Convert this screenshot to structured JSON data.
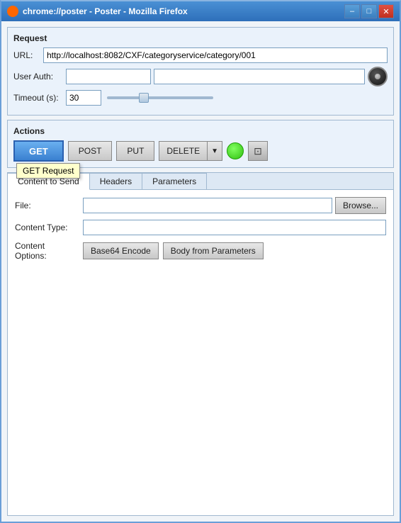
{
  "window": {
    "title": "chrome://poster - Poster - Mozilla Firefox",
    "controls": {
      "minimize": "–",
      "maximize": "□",
      "close": "✕"
    }
  },
  "request": {
    "section_title": "Request",
    "url_label": "URL:",
    "url_value": "http://localhost:8082/CXF/categoryservice/category/001",
    "user_auth_label": "User Auth:",
    "user_auth_placeholder": "",
    "password_placeholder": "",
    "timeout_label": "Timeout (s):",
    "timeout_value": "30"
  },
  "actions": {
    "section_title": "Actions",
    "get_label": "GET",
    "post_label": "POST",
    "put_label": "PUT",
    "delete_label": "DELETE",
    "tooltip": "GET Request"
  },
  "tabs": {
    "content_to_send_label": "Content to Send",
    "headers_label": "Headers",
    "parameters_label": "Parameters"
  },
  "content_panel": {
    "file_label": "File:",
    "file_placeholder": "",
    "browse_label": "Browse...",
    "content_type_label": "Content Type:",
    "content_type_value": "",
    "content_options_label": "Content Options:",
    "base64_label": "Base64 Encode",
    "body_from_params_label": "Body from Parameters"
  }
}
